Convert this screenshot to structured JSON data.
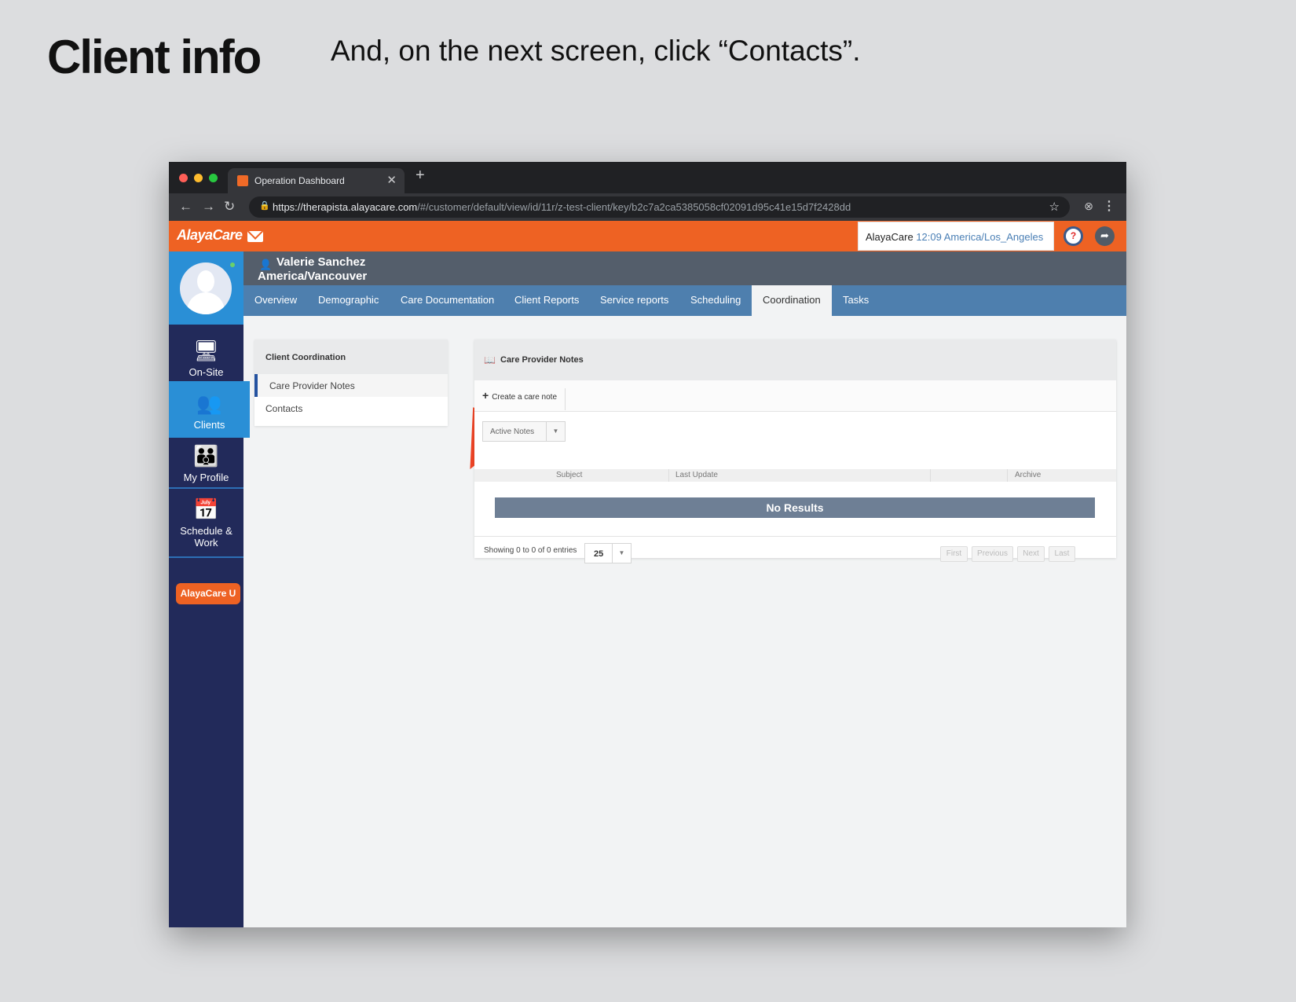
{
  "slide": {
    "title": "Client info",
    "caption": "And, on the next screen, click “Contacts”."
  },
  "browser": {
    "tab_title": "Operation Dashboard",
    "url_host": "https://therapista.alayacare.com",
    "url_path": "/#/customer/default/view/id/11r/z-test-client/key/b2c7a2ca5385058cf02091d95c41e15d7f2428dd"
  },
  "header": {
    "logo": "AlayaCare",
    "org": "AlayaCare",
    "time": "12:09 America/Los_Angeles",
    "help": "?"
  },
  "leftnav": {
    "items": [
      {
        "label": "On-Site",
        "icon": "monitor-icon"
      },
      {
        "label": "Clients",
        "icon": "clients-icon"
      },
      {
        "label": "My Profile",
        "icon": "profile-icon"
      },
      {
        "label": "Schedule & Work",
        "icon": "calendar-icon"
      }
    ],
    "university_button": "AlayaCare U"
  },
  "client": {
    "name": "Valerie Sanchez",
    "timezone": "America/Vancouver"
  },
  "tabs": [
    "Overview",
    "Demographic",
    "Care Documentation",
    "Client Reports",
    "Service reports",
    "Scheduling",
    "Coordination",
    "Tasks"
  ],
  "active_tab": "Coordination",
  "sidepanel": {
    "title": "Client Coordination",
    "items": [
      "Care Provider Notes",
      "Contacts"
    ]
  },
  "main": {
    "title": "Care Provider Notes",
    "create_button": "Create a care note",
    "filter_value": "Active Notes",
    "columns": [
      "Subject",
      "Last Update",
      "Archive"
    ],
    "empty_message": "No Results",
    "entries_info": "Showing 0 to 0 of 0 entries",
    "page_size": "25",
    "pagination": [
      "First",
      "Previous",
      "Next",
      "Last"
    ]
  },
  "colors": {
    "brand_orange": "#ee6223",
    "nav_dark": "#222a5a",
    "tab_blue": "#4e7fae",
    "arrow_red": "#ec4325"
  }
}
